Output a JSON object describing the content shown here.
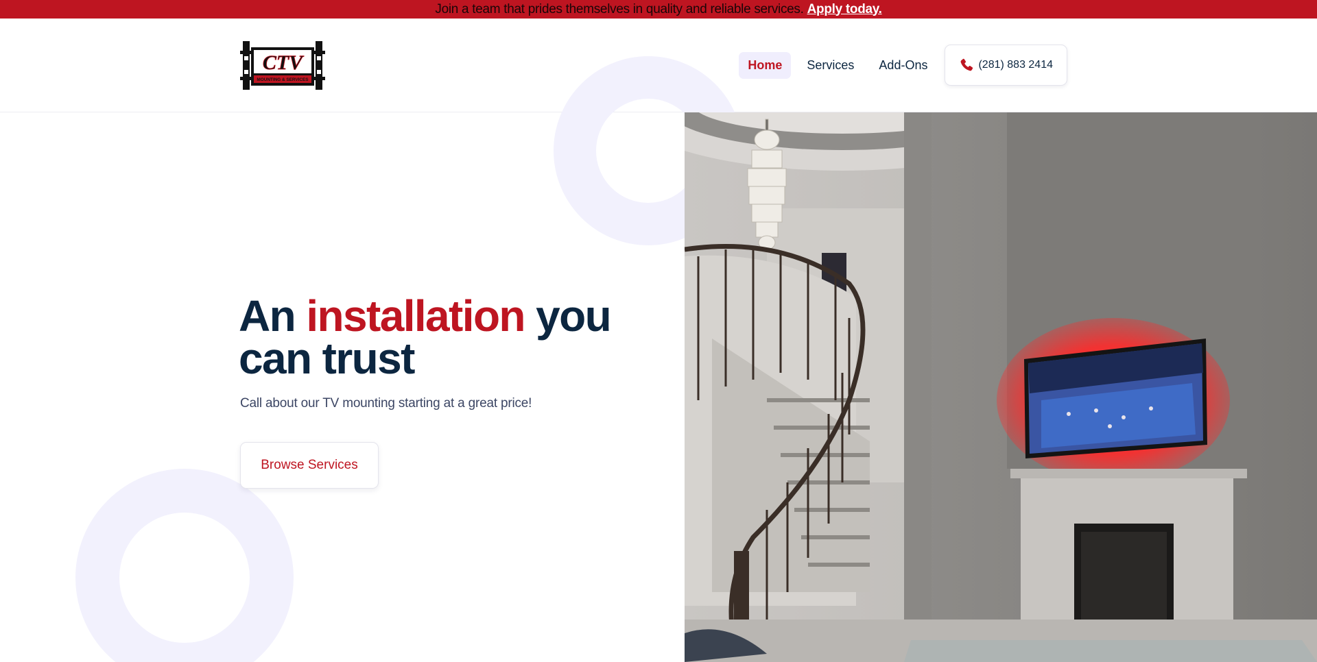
{
  "announcement": {
    "text": "Join a team that prides themselves in quality and reliable services.",
    "link_label": "Apply today."
  },
  "brand": {
    "logo_text": "CTV",
    "logo_subtext": "MOUNTING & SERVICES"
  },
  "nav": {
    "items": [
      {
        "label": "Home",
        "active": true
      },
      {
        "label": "Services",
        "active": false
      },
      {
        "label": "Add-Ons",
        "active": false
      }
    ],
    "phone_label": "(281) 883 2414",
    "phone_icon": "phone-icon"
  },
  "hero": {
    "title_prefix": "An",
    "title_accent": "installation",
    "title_suffix": "you can trust",
    "subtitle": "Call about our TV mounting starting at a great price!",
    "cta_label": "Browse Services"
  },
  "colors": {
    "brand_red": "#be1521",
    "navy": "#0c2640",
    "lavender": "#f0eefd"
  }
}
